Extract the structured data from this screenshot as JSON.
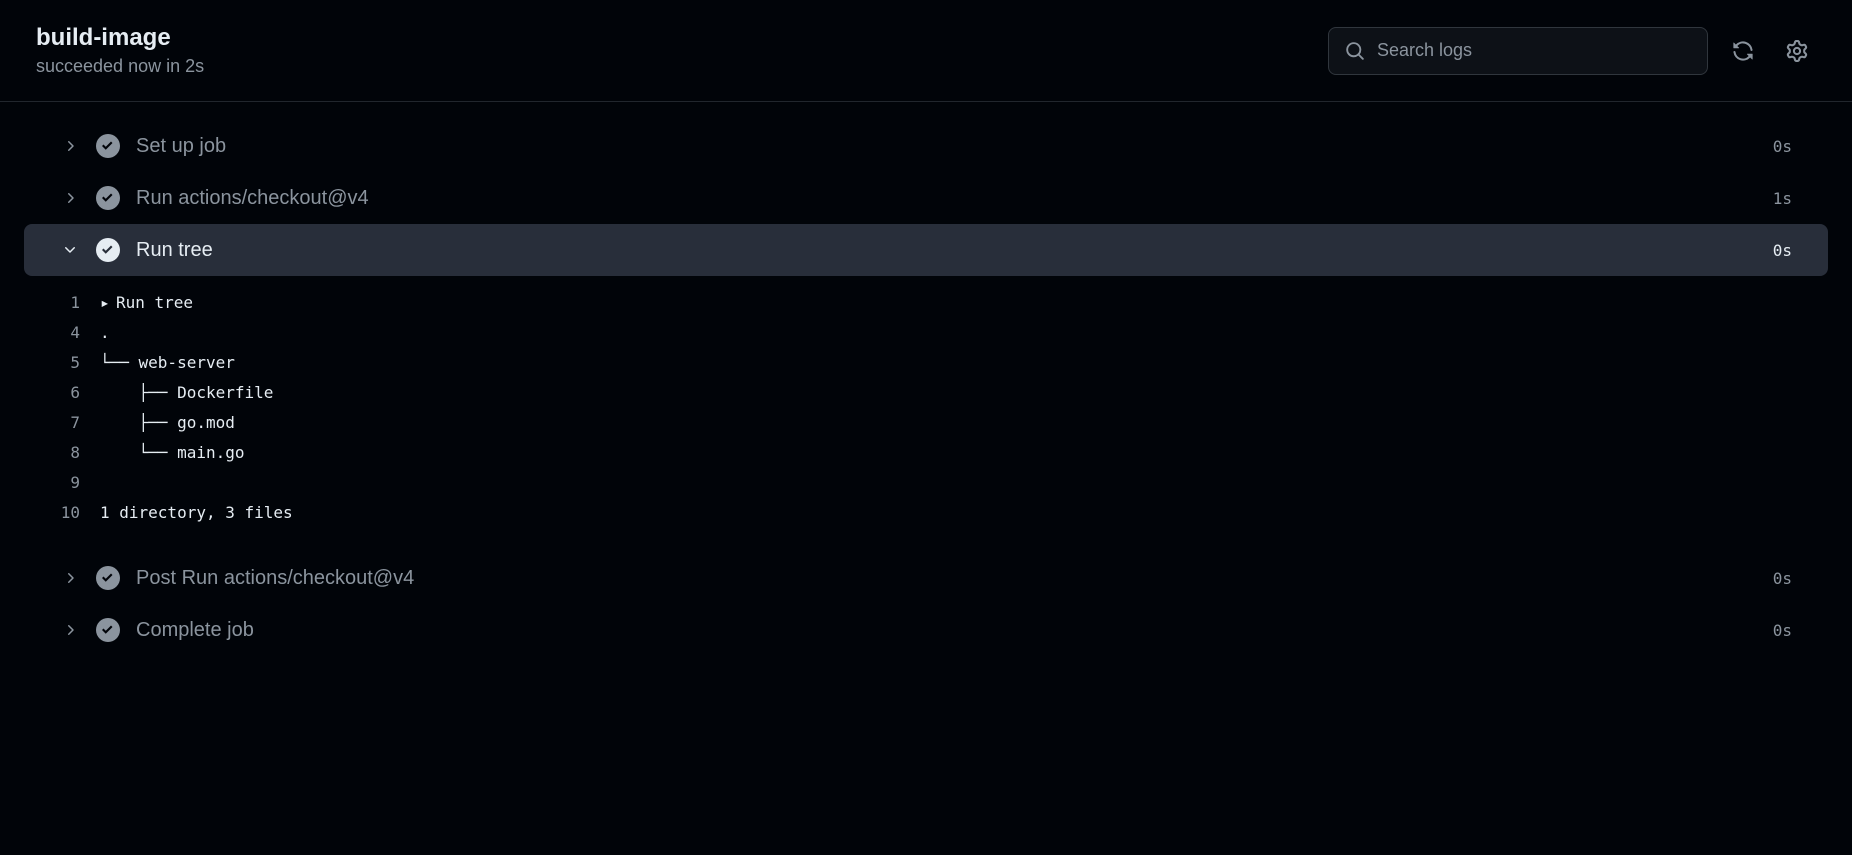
{
  "header": {
    "title": "build-image",
    "status": "succeeded now in 2s",
    "search_placeholder": "Search logs"
  },
  "steps": [
    {
      "name": "Set up job",
      "duration": "0s",
      "expanded": false
    },
    {
      "name": "Run actions/checkout@v4",
      "duration": "1s",
      "expanded": false
    },
    {
      "name": "Run tree",
      "duration": "0s",
      "expanded": true
    },
    {
      "name": "Post Run actions/checkout@v4",
      "duration": "0s",
      "expanded": false
    },
    {
      "name": "Complete job",
      "duration": "0s",
      "expanded": false
    }
  ],
  "log": {
    "lines": [
      {
        "num": "1",
        "disclosure": "▸",
        "text": "Run tree"
      },
      {
        "num": "4",
        "disclosure": "",
        "text": "."
      },
      {
        "num": "5",
        "disclosure": "",
        "text": "└── web-server"
      },
      {
        "num": "6",
        "disclosure": "",
        "text": "    ├── Dockerfile"
      },
      {
        "num": "7",
        "disclosure": "",
        "text": "    ├── go.mod"
      },
      {
        "num": "8",
        "disclosure": "",
        "text": "    └── main.go"
      },
      {
        "num": "9",
        "disclosure": "",
        "text": ""
      },
      {
        "num": "10",
        "disclosure": "",
        "text": "1 directory, 3 files"
      }
    ]
  }
}
